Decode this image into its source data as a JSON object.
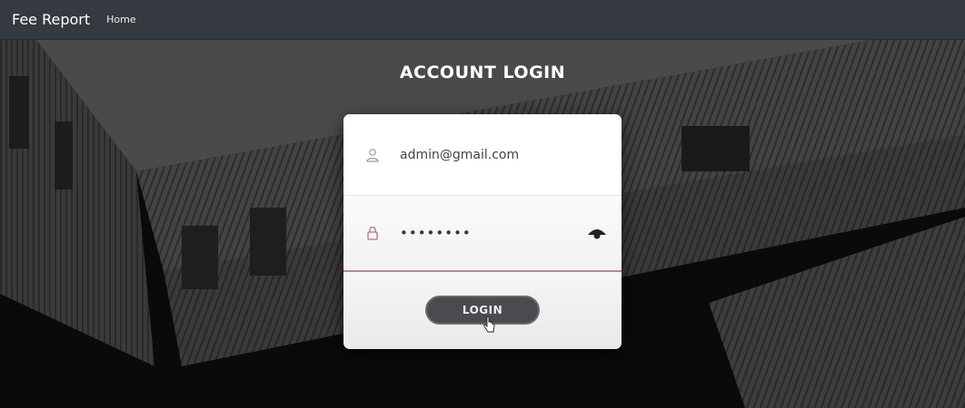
{
  "navbar": {
    "brand": "Fee Report",
    "links": [
      "Home"
    ]
  },
  "page": {
    "title": "ACCOUNT LOGIN"
  },
  "form": {
    "email": {
      "value": "admin@gmail.com",
      "icon": "user-icon"
    },
    "password": {
      "masked_value": "••••••••",
      "icon": "lock-icon",
      "toggle_icon": "eye-icon"
    },
    "submit_label": "LOGIN"
  },
  "colors": {
    "navbar": "#343a40",
    "button": "#4b4a4f",
    "accent": "#b38a9c"
  }
}
